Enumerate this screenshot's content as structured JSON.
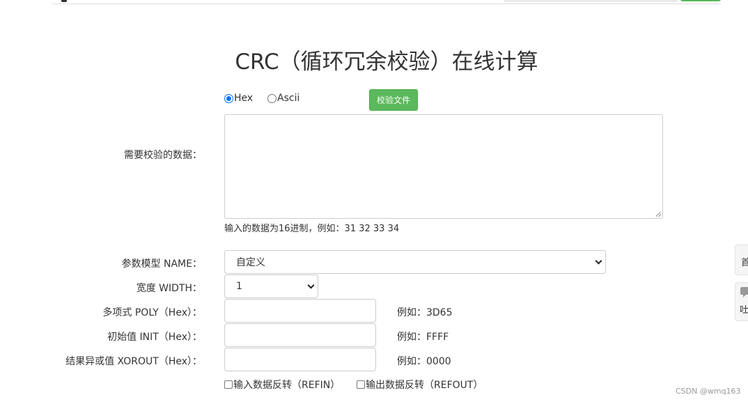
{
  "page": {
    "title": "CRC（循环冗余校验）在线计算"
  },
  "input_mode": {
    "options": [
      {
        "label": "Hex",
        "checked": true
      },
      {
        "label": "Ascii",
        "checked": false
      }
    ],
    "check_file_label": "校验文件"
  },
  "data_field": {
    "label": "需要校验的数据：",
    "value": "",
    "hint": "输入的数据为16进制，例如：31 32 33 34"
  },
  "params": {
    "model": {
      "label": "参数模型 NAME：",
      "selected": "自定义"
    },
    "width": {
      "label": "宽度 WIDTH：",
      "selected": "1"
    },
    "poly": {
      "label": "多项式 POLY（Hex）：",
      "value": "",
      "example": "例如：3D65"
    },
    "init": {
      "label": "初始值 INIT（Hex）：",
      "value": "",
      "example": "例如：FFFF"
    },
    "xorout": {
      "label": "结果异或值 XOROUT（Hex）：",
      "value": "",
      "example": "例如：0000"
    },
    "refin": {
      "label": "输入数据反转（REFIN）",
      "checked": false
    },
    "refout": {
      "label": "输出数据反转（REFOUT）",
      "checked": false
    }
  },
  "side_tabs": {
    "first": "首",
    "second": "吐"
  },
  "watermark": "CSDN @wmq163",
  "colors": {
    "button_green": "#5cb85c",
    "radio_blue": "#0075ff"
  }
}
